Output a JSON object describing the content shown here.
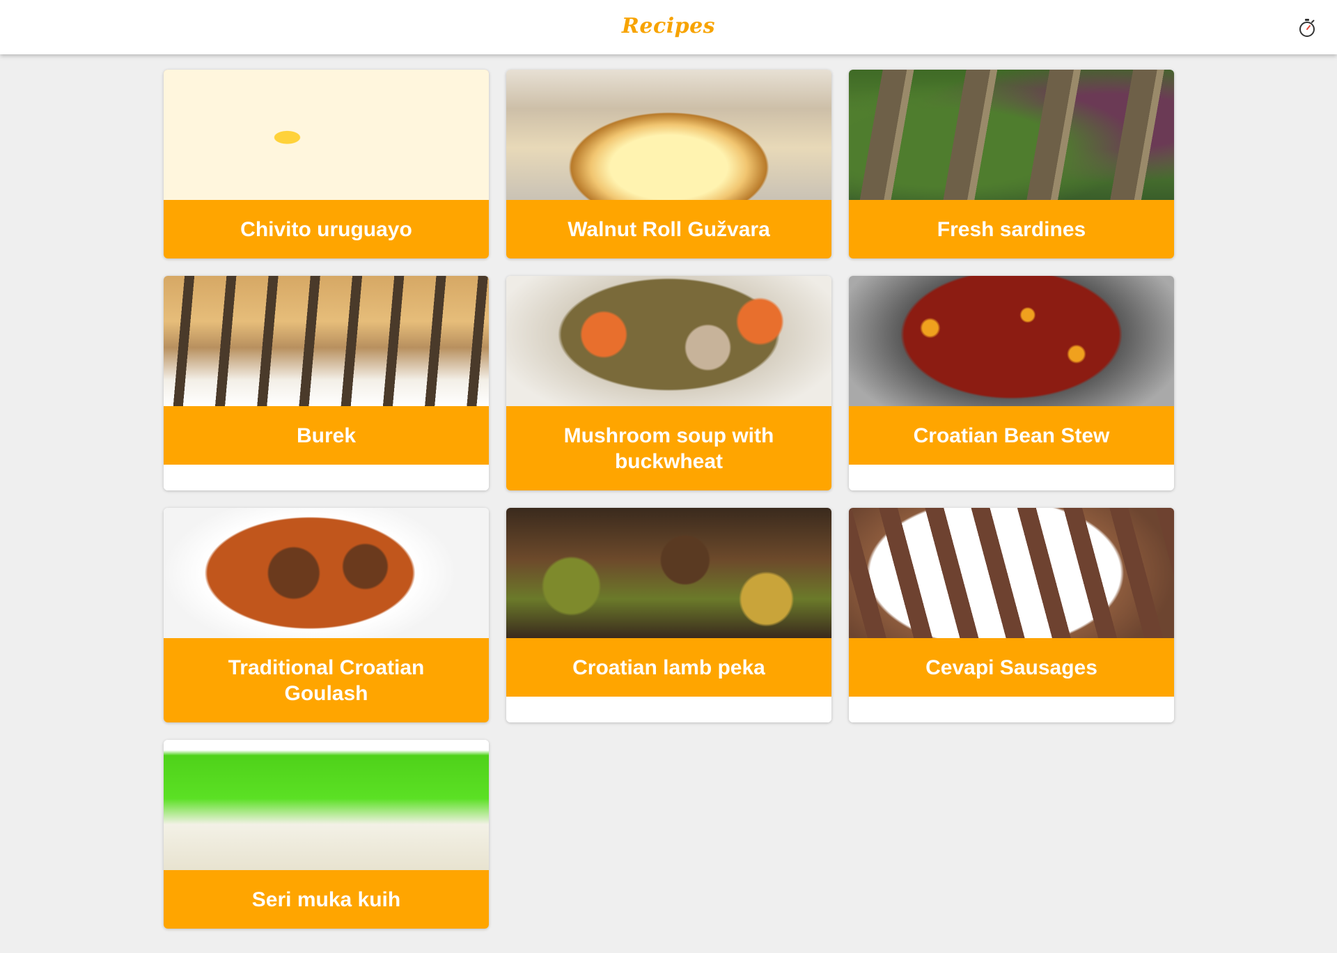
{
  "header": {
    "title": "Recipes",
    "timer_icon": "stopwatch-icon"
  },
  "colors": {
    "brand": "#f7a300",
    "card_label_bg": "#ffa500",
    "page_bg": "#efefef"
  },
  "recipes": [
    {
      "name": "Chivito uruguayo",
      "image": "chivito-photo"
    },
    {
      "name": "Walnut Roll Gužvara",
      "image": "walnut-roll-photo"
    },
    {
      "name": "Fresh sardines",
      "image": "sardines-photo"
    },
    {
      "name": "Burek",
      "image": "burek-photo"
    },
    {
      "name": "Mushroom soup with buckwheat",
      "image": "mushroom-soup-photo"
    },
    {
      "name": "Croatian Bean Stew",
      "image": "bean-stew-photo"
    },
    {
      "name": "Traditional Croatian Goulash",
      "image": "goulash-photo"
    },
    {
      "name": "Croatian lamb peka",
      "image": "lamb-peka-photo"
    },
    {
      "name": "Cevapi Sausages",
      "image": "cevapi-photo"
    },
    {
      "name": "Seri muka kuih",
      "image": "seri-muka-photo"
    }
  ]
}
